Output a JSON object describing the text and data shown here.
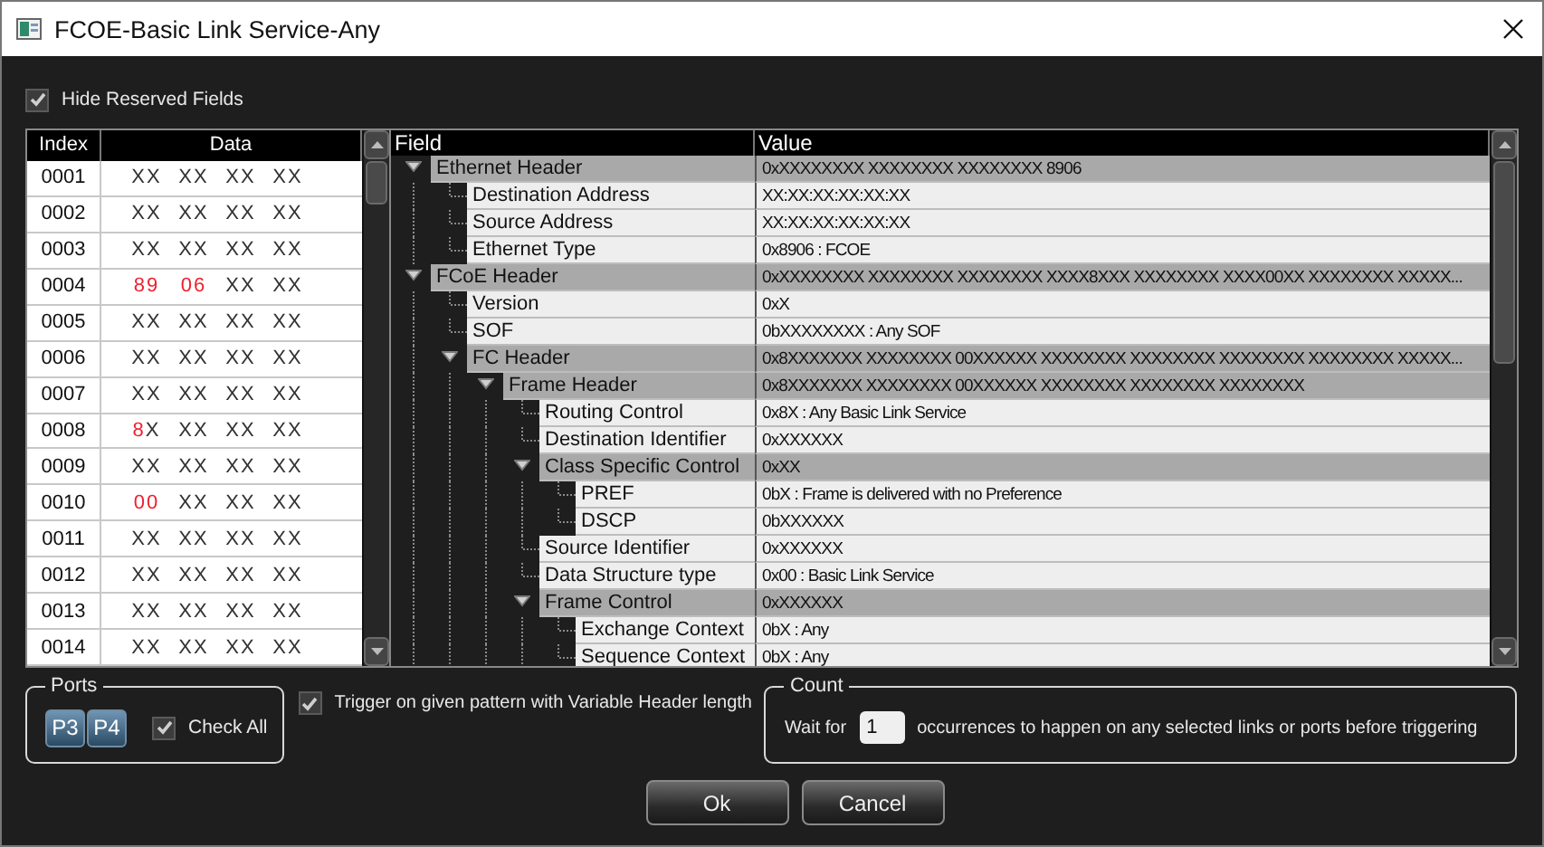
{
  "window": {
    "title": "FCOE-Basic Link Service-Any"
  },
  "hide_reserved_fields": {
    "label": "Hide Reserved Fields",
    "checked": true
  },
  "data_table": {
    "columns": [
      "Index",
      "Data"
    ],
    "rows": [
      {
        "index": "0001",
        "bytes": [
          {
            "nibbles": [
              {
                "text": "X",
                "set": false
              },
              {
                "text": "X",
                "set": false
              }
            ]
          },
          {
            "nibbles": [
              {
                "text": "X",
                "set": false
              },
              {
                "text": "X",
                "set": false
              }
            ]
          },
          {
            "nibbles": [
              {
                "text": "X",
                "set": false
              },
              {
                "text": "X",
                "set": false
              }
            ]
          },
          {
            "nibbles": [
              {
                "text": "X",
                "set": false
              },
              {
                "text": "X",
                "set": false
              }
            ]
          }
        ]
      },
      {
        "index": "0002",
        "bytes": [
          {
            "nibbles": [
              {
                "text": "X",
                "set": false
              },
              {
                "text": "X",
                "set": false
              }
            ]
          },
          {
            "nibbles": [
              {
                "text": "X",
                "set": false
              },
              {
                "text": "X",
                "set": false
              }
            ]
          },
          {
            "nibbles": [
              {
                "text": "X",
                "set": false
              },
              {
                "text": "X",
                "set": false
              }
            ]
          },
          {
            "nibbles": [
              {
                "text": "X",
                "set": false
              },
              {
                "text": "X",
                "set": false
              }
            ]
          }
        ]
      },
      {
        "index": "0003",
        "bytes": [
          {
            "nibbles": [
              {
                "text": "X",
                "set": false
              },
              {
                "text": "X",
                "set": false
              }
            ]
          },
          {
            "nibbles": [
              {
                "text": "X",
                "set": false
              },
              {
                "text": "X",
                "set": false
              }
            ]
          },
          {
            "nibbles": [
              {
                "text": "X",
                "set": false
              },
              {
                "text": "X",
                "set": false
              }
            ]
          },
          {
            "nibbles": [
              {
                "text": "X",
                "set": false
              },
              {
                "text": "X",
                "set": false
              }
            ]
          }
        ]
      },
      {
        "index": "0004",
        "bytes": [
          {
            "nibbles": [
              {
                "text": "8",
                "set": true
              },
              {
                "text": "9",
                "set": true
              }
            ]
          },
          {
            "nibbles": [
              {
                "text": "0",
                "set": true
              },
              {
                "text": "6",
                "set": true
              }
            ]
          },
          {
            "nibbles": [
              {
                "text": "X",
                "set": false
              },
              {
                "text": "X",
                "set": false
              }
            ]
          },
          {
            "nibbles": [
              {
                "text": "X",
                "set": false
              },
              {
                "text": "X",
                "set": false
              }
            ]
          }
        ]
      },
      {
        "index": "0005",
        "bytes": [
          {
            "nibbles": [
              {
                "text": "X",
                "set": false
              },
              {
                "text": "X",
                "set": false
              }
            ]
          },
          {
            "nibbles": [
              {
                "text": "X",
                "set": false
              },
              {
                "text": "X",
                "set": false
              }
            ]
          },
          {
            "nibbles": [
              {
                "text": "X",
                "set": false
              },
              {
                "text": "X",
                "set": false
              }
            ]
          },
          {
            "nibbles": [
              {
                "text": "X",
                "set": false
              },
              {
                "text": "X",
                "set": false
              }
            ]
          }
        ]
      },
      {
        "index": "0006",
        "bytes": [
          {
            "nibbles": [
              {
                "text": "X",
                "set": false
              },
              {
                "text": "X",
                "set": false
              }
            ]
          },
          {
            "nibbles": [
              {
                "text": "X",
                "set": false
              },
              {
                "text": "X",
                "set": false
              }
            ]
          },
          {
            "nibbles": [
              {
                "text": "X",
                "set": false
              },
              {
                "text": "X",
                "set": false
              }
            ]
          },
          {
            "nibbles": [
              {
                "text": "X",
                "set": false
              },
              {
                "text": "X",
                "set": false
              }
            ]
          }
        ]
      },
      {
        "index": "0007",
        "bytes": [
          {
            "nibbles": [
              {
                "text": "X",
                "set": false
              },
              {
                "text": "X",
                "set": false
              }
            ]
          },
          {
            "nibbles": [
              {
                "text": "X",
                "set": false
              },
              {
                "text": "X",
                "set": false
              }
            ]
          },
          {
            "nibbles": [
              {
                "text": "X",
                "set": false
              },
              {
                "text": "X",
                "set": false
              }
            ]
          },
          {
            "nibbles": [
              {
                "text": "X",
                "set": false
              },
              {
                "text": "X",
                "set": false
              }
            ]
          }
        ]
      },
      {
        "index": "0008",
        "bytes": [
          {
            "nibbles": [
              {
                "text": "8",
                "set": true
              },
              {
                "text": "X",
                "set": false
              }
            ]
          },
          {
            "nibbles": [
              {
                "text": "X",
                "set": false
              },
              {
                "text": "X",
                "set": false
              }
            ]
          },
          {
            "nibbles": [
              {
                "text": "X",
                "set": false
              },
              {
                "text": "X",
                "set": false
              }
            ]
          },
          {
            "nibbles": [
              {
                "text": "X",
                "set": false
              },
              {
                "text": "X",
                "set": false
              }
            ]
          }
        ]
      },
      {
        "index": "0009",
        "bytes": [
          {
            "nibbles": [
              {
                "text": "X",
                "set": false
              },
              {
                "text": "X",
                "set": false
              }
            ]
          },
          {
            "nibbles": [
              {
                "text": "X",
                "set": false
              },
              {
                "text": "X",
                "set": false
              }
            ]
          },
          {
            "nibbles": [
              {
                "text": "X",
                "set": false
              },
              {
                "text": "X",
                "set": false
              }
            ]
          },
          {
            "nibbles": [
              {
                "text": "X",
                "set": false
              },
              {
                "text": "X",
                "set": false
              }
            ]
          }
        ]
      },
      {
        "index": "0010",
        "bytes": [
          {
            "nibbles": [
              {
                "text": "0",
                "set": true
              },
              {
                "text": "0",
                "set": true
              }
            ]
          },
          {
            "nibbles": [
              {
                "text": "X",
                "set": false
              },
              {
                "text": "X",
                "set": false
              }
            ]
          },
          {
            "nibbles": [
              {
                "text": "X",
                "set": false
              },
              {
                "text": "X",
                "set": false
              }
            ]
          },
          {
            "nibbles": [
              {
                "text": "X",
                "set": false
              },
              {
                "text": "X",
                "set": false
              }
            ]
          }
        ]
      },
      {
        "index": "0011",
        "bytes": [
          {
            "nibbles": [
              {
                "text": "X",
                "set": false
              },
              {
                "text": "X",
                "set": false
              }
            ]
          },
          {
            "nibbles": [
              {
                "text": "X",
                "set": false
              },
              {
                "text": "X",
                "set": false
              }
            ]
          },
          {
            "nibbles": [
              {
                "text": "X",
                "set": false
              },
              {
                "text": "X",
                "set": false
              }
            ]
          },
          {
            "nibbles": [
              {
                "text": "X",
                "set": false
              },
              {
                "text": "X",
                "set": false
              }
            ]
          }
        ]
      },
      {
        "index": "0012",
        "bytes": [
          {
            "nibbles": [
              {
                "text": "X",
                "set": false
              },
              {
                "text": "X",
                "set": false
              }
            ]
          },
          {
            "nibbles": [
              {
                "text": "X",
                "set": false
              },
              {
                "text": "X",
                "set": false
              }
            ]
          },
          {
            "nibbles": [
              {
                "text": "X",
                "set": false
              },
              {
                "text": "X",
                "set": false
              }
            ]
          },
          {
            "nibbles": [
              {
                "text": "X",
                "set": false
              },
              {
                "text": "X",
                "set": false
              }
            ]
          }
        ]
      },
      {
        "index": "0013",
        "bytes": [
          {
            "nibbles": [
              {
                "text": "X",
                "set": false
              },
              {
                "text": "X",
                "set": false
              }
            ]
          },
          {
            "nibbles": [
              {
                "text": "X",
                "set": false
              },
              {
                "text": "X",
                "set": false
              }
            ]
          },
          {
            "nibbles": [
              {
                "text": "X",
                "set": false
              },
              {
                "text": "X",
                "set": false
              }
            ]
          },
          {
            "nibbles": [
              {
                "text": "X",
                "set": false
              },
              {
                "text": "X",
                "set": false
              }
            ]
          }
        ]
      },
      {
        "index": "0014",
        "bytes": [
          {
            "nibbles": [
              {
                "text": "X",
                "set": false
              },
              {
                "text": "X",
                "set": false
              }
            ]
          },
          {
            "nibbles": [
              {
                "text": "X",
                "set": false
              },
              {
                "text": "X",
                "set": false
              }
            ]
          },
          {
            "nibbles": [
              {
                "text": "X",
                "set": false
              },
              {
                "text": "X",
                "set": false
              }
            ]
          },
          {
            "nibbles": [
              {
                "text": "X",
                "set": false
              },
              {
                "text": "X",
                "set": false
              }
            ]
          }
        ]
      }
    ]
  },
  "field_tree": {
    "columns": [
      "Field",
      "Value"
    ],
    "nodes": [
      {
        "name": "Ethernet Header",
        "value": "0xXXXXXXXX XXXXXXXX XXXXXXXX 8906",
        "expanded": true,
        "children": [
          {
            "name": "Destination Address",
            "value": "XX:XX:XX:XX:XX:XX"
          },
          {
            "name": "Source Address",
            "value": "XX:XX:XX:XX:XX:XX"
          },
          {
            "name": "Ethernet Type",
            "value": "0x8906 : FCOE"
          }
        ]
      },
      {
        "name": "FCoE Header",
        "value": "0xXXXXXXXX XXXXXXXX XXXXXXXX XXXX8XXX XXXXXXXX XXXX00XX XXXXXXXX XXXXX...",
        "expanded": true,
        "children": [
          {
            "name": "Version",
            "value": "0xX"
          },
          {
            "name": "SOF",
            "value": "0bXXXXXXXX : Any SOF"
          },
          {
            "name": "FC Header",
            "value": "0x8XXXXXXX XXXXXXXX 00XXXXXX XXXXXXXX XXXXXXXX XXXXXXXX XXXXXXXX XXXXX...",
            "expanded": true,
            "children": [
              {
                "name": "Frame Header",
                "value": "0x8XXXXXXX XXXXXXXX 00XXXXXX XXXXXXXX XXXXXXXX XXXXXXXX",
                "expanded": true,
                "children": [
                  {
                    "name": "Routing Control",
                    "value": "0x8X : Any Basic Link Service"
                  },
                  {
                    "name": "Destination Identifier",
                    "value": "0xXXXXXX"
                  },
                  {
                    "name": "Class Specific Control",
                    "value": "0xXX",
                    "expanded": true,
                    "children": [
                      {
                        "name": "PREF",
                        "value": "0bX : Frame is delivered with no Preference"
                      },
                      {
                        "name": "DSCP",
                        "value": "0bXXXXXX"
                      }
                    ]
                  },
                  {
                    "name": "Source Identifier",
                    "value": "0xXXXXXX"
                  },
                  {
                    "name": "Data Structure type",
                    "value": "0x00 : Basic Link Service"
                  },
                  {
                    "name": "Frame Control",
                    "value": "0xXXXXXX",
                    "expanded": true,
                    "children": [
                      {
                        "name": "Exchange Context",
                        "value": "0bX : Any"
                      },
                      {
                        "name": "Sequence Context",
                        "value": "0bX : Any"
                      }
                    ]
                  }
                ]
              }
            ]
          }
        ]
      }
    ]
  },
  "ports": {
    "title": "Ports",
    "buttons": [
      {
        "label": "P3",
        "selected": true
      },
      {
        "label": "P4",
        "selected": true
      }
    ],
    "check_all": {
      "label": "Check All",
      "checked": true
    }
  },
  "variable_header": {
    "label": "Trigger on given pattern with Variable Header length",
    "checked": true
  },
  "count": {
    "title": "Count",
    "prefix": "Wait for",
    "value": "1",
    "suffix": "occurrences to happen on any selected links or ports before triggering"
  },
  "buttons": [
    "Ok",
    "Cancel"
  ]
}
